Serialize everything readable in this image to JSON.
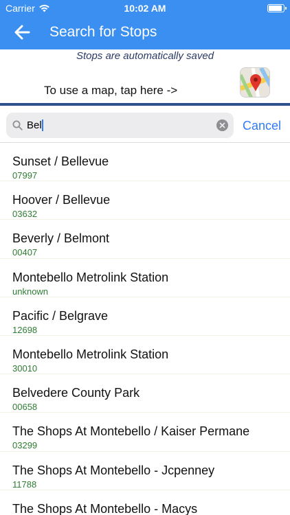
{
  "status": {
    "carrier": "Carrier",
    "time": "10:02 AM"
  },
  "nav": {
    "title": "Search for Stops"
  },
  "note": "Stops are automatically saved",
  "map_prompt": "To use a map, tap here ->",
  "search": {
    "value": "Bel",
    "cancel_label": "Cancel"
  },
  "stops": [
    {
      "name": "Sunset / Bellevue",
      "id": "07997"
    },
    {
      "name": "Hoover / Bellevue",
      "id": "03632"
    },
    {
      "name": "Beverly / Belmont",
      "id": "00407"
    },
    {
      "name": "Montebello Metrolink Station",
      "id": "unknown"
    },
    {
      "name": "Pacific / Belgrave",
      "id": "12698"
    },
    {
      "name": "Montebello Metrolink Station",
      "id": "30010"
    },
    {
      "name": "Belvedere County Park",
      "id": "00658"
    },
    {
      "name": "The Shops At Montebello / Kaiser Permane",
      "id": "03299"
    },
    {
      "name": "The Shops At Montebello - Jcpenney",
      "id": "11788"
    },
    {
      "name": "The Shops At Montebello - Macys",
      "id": ""
    }
  ]
}
